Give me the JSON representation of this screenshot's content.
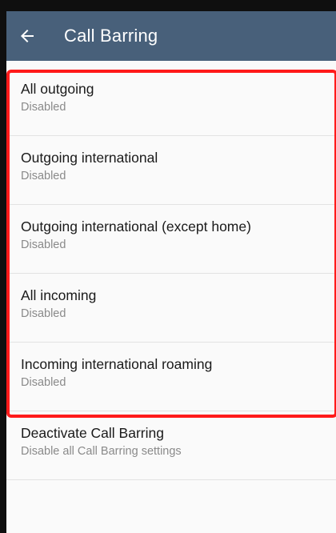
{
  "app_bar": {
    "title": "Call Barring",
    "back_icon": "arrow-left-icon"
  },
  "items": [
    {
      "title": "All outgoing",
      "subtitle": "Disabled"
    },
    {
      "title": "Outgoing international",
      "subtitle": "Disabled"
    },
    {
      "title": "Outgoing international (except home)",
      "subtitle": "Disabled"
    },
    {
      "title": "All incoming",
      "subtitle": "Disabled"
    },
    {
      "title": "Incoming international roaming",
      "subtitle": "Disabled"
    },
    {
      "title": "Deactivate Call Barring",
      "subtitle": "Disable all Call Barring settings"
    }
  ],
  "colors": {
    "app_bar": "#48607a",
    "highlight": "#ff1a1a"
  }
}
